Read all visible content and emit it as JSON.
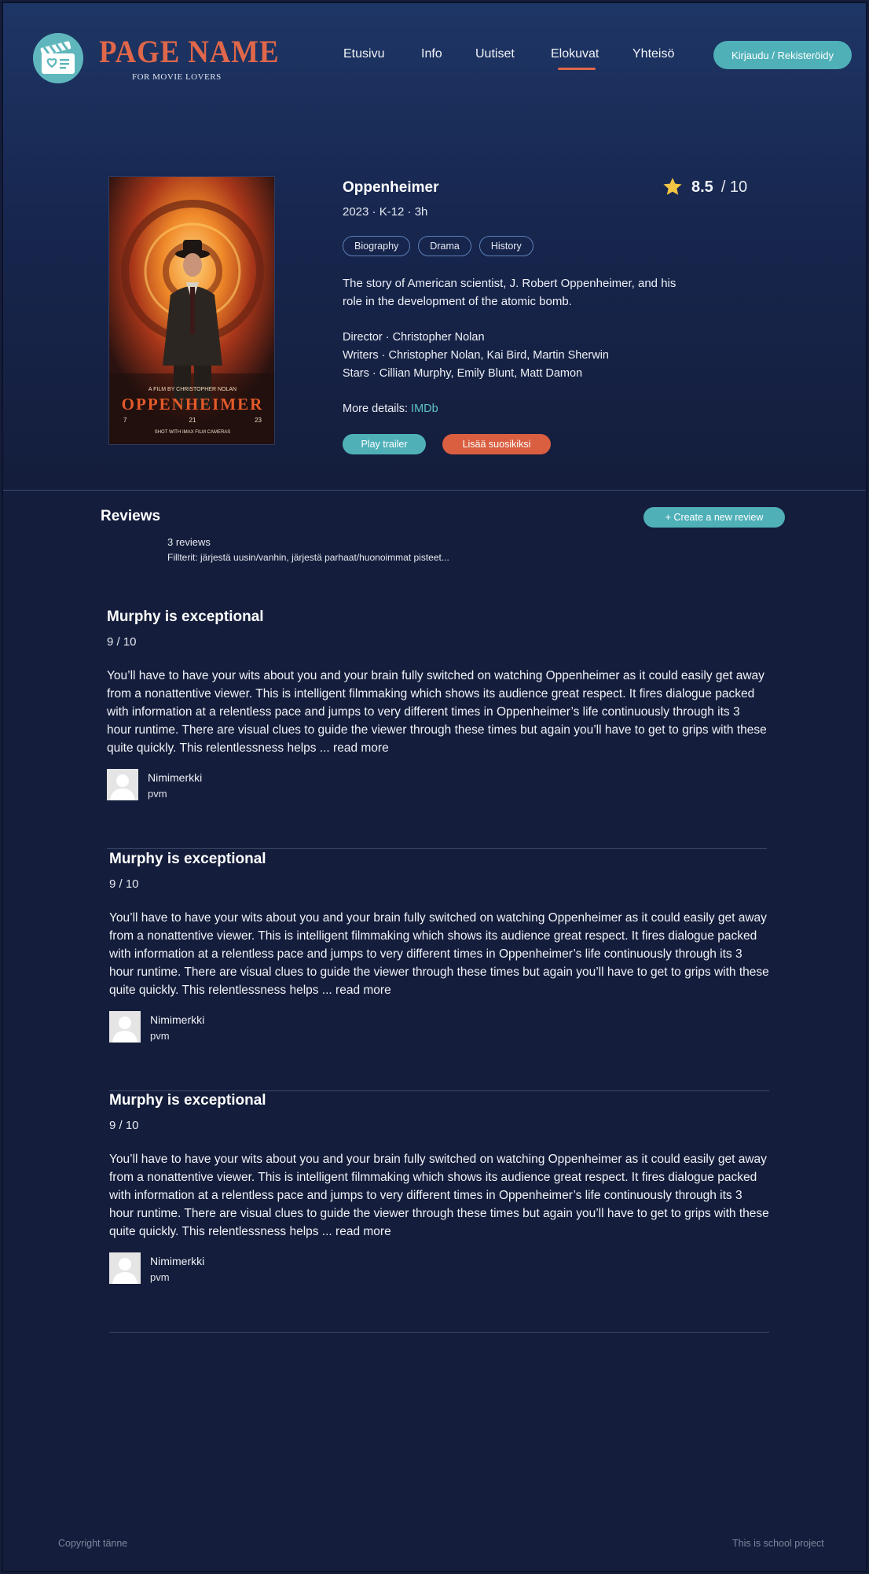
{
  "header": {
    "brand_name": "PAGE NAME",
    "brand_tagline": "FOR MOVIE LOVERS",
    "nav": [
      {
        "label": "Etusivu"
      },
      {
        "label": "Info"
      },
      {
        "label": "Uutiset"
      },
      {
        "label": "Elokuvat",
        "active": true
      },
      {
        "label": "Yhteisö"
      }
    ],
    "login_label": "Kirjaudu / Rekisteröidy"
  },
  "movie": {
    "title": "Oppenheimer",
    "meta": "2023 · K-12 · 3h",
    "rating": "8.5",
    "rating_max": "/ 10",
    "genres": [
      "Biography",
      "Drama",
      "History"
    ],
    "synopsis": "The story of American scientist, J. Robert Oppenheimer, and his role in the development of the atomic bomb.",
    "director": "Director · Christopher Nolan",
    "writers": "Writers · Christopher Nolan, Kai Bird, Martin Sherwin",
    "stars": "Stars · Cillian Murphy, Emily Blunt, Matt Damon",
    "more_details_label": "More details:",
    "more_details_link": "IMDb",
    "trailer_label": "Play trailer",
    "favorite_label": "Lisää suosikiksi",
    "poster": {
      "credits_line": "A FILM BY CHRISTOPHER NOLAN",
      "title": "OPPENHEIMER",
      "date_left": "7",
      "date_mid": "21",
      "date_right": "23",
      "imax_line": "SHOT WITH IMAX FILM CAMERAS"
    }
  },
  "reviews": {
    "heading": "Reviews",
    "create_label": "+ Create a new review",
    "count": "3 reviews",
    "filters": "Fillterit: järjestä uusin/vanhin, järjestä parhaat/huonoimmat pisteet...",
    "items": [
      {
        "title": "Murphy is exceptional",
        "score": "9 / 10",
        "body": "You’ll have to have your wits about you and your brain fully switched on watching Oppenheimer as it could easily get away from a nonattentive viewer. This is intelligent filmmaking which shows its audience great respect. It fires dialogue packed with information at a relentless pace and jumps to very different times in Oppenheimer’s life continuously through its 3 hour runtime. There are visual clues to guide the viewer through these times but again you’ll have to get to grips with these quite quickly. This relentlessness helps ...",
        "read_more": "read more",
        "nickname": "Nimimerkki",
        "date": "pvm"
      },
      {
        "title": "Murphy is exceptional",
        "score": "9 / 10",
        "body": "You’ll have to have your wits about you and your brain fully switched on watching Oppenheimer as it could easily get away from a nonattentive viewer. This is intelligent filmmaking which shows its audience great respect. It fires dialogue packed with information at a relentless pace and jumps to very different times in Oppenheimer’s life continuously through its 3 hour runtime. There are visual clues to guide the viewer through these times but again you’ll have to get to grips with these quite quickly. This relentlessness helps ...",
        "read_more": "read more",
        "nickname": "Nimimerkki",
        "date": "pvm"
      },
      {
        "title": "Murphy is exceptional",
        "score": "9 / 10",
        "body": "You’ll have to have your wits about you and your brain fully switched on watching Oppenheimer as it could easily get away from a nonattentive viewer. This is intelligent filmmaking which shows its audience great respect. It fires dialogue packed with information at a relentless pace and jumps to very different times in Oppenheimer’s life continuously through its 3 hour runtime. There are visual clues to guide the viewer through these times but again you’ll have to get to grips with these quite quickly. This relentlessness helps ...",
        "read_more": "read more",
        "nickname": "Nimimerkki",
        "date": "pvm"
      }
    ]
  },
  "footer": {
    "left": "Copyright tänne",
    "right": "This is school project"
  },
  "colors": {
    "accent_teal": "#4fb0b8",
    "accent_orange": "#d95f40",
    "background": "#141d3b",
    "star": "#f4c542"
  },
  "icons": {
    "logo": "film-clapper-heart-icon",
    "rating": "star-icon",
    "avatar": "user-placeholder-icon"
  }
}
